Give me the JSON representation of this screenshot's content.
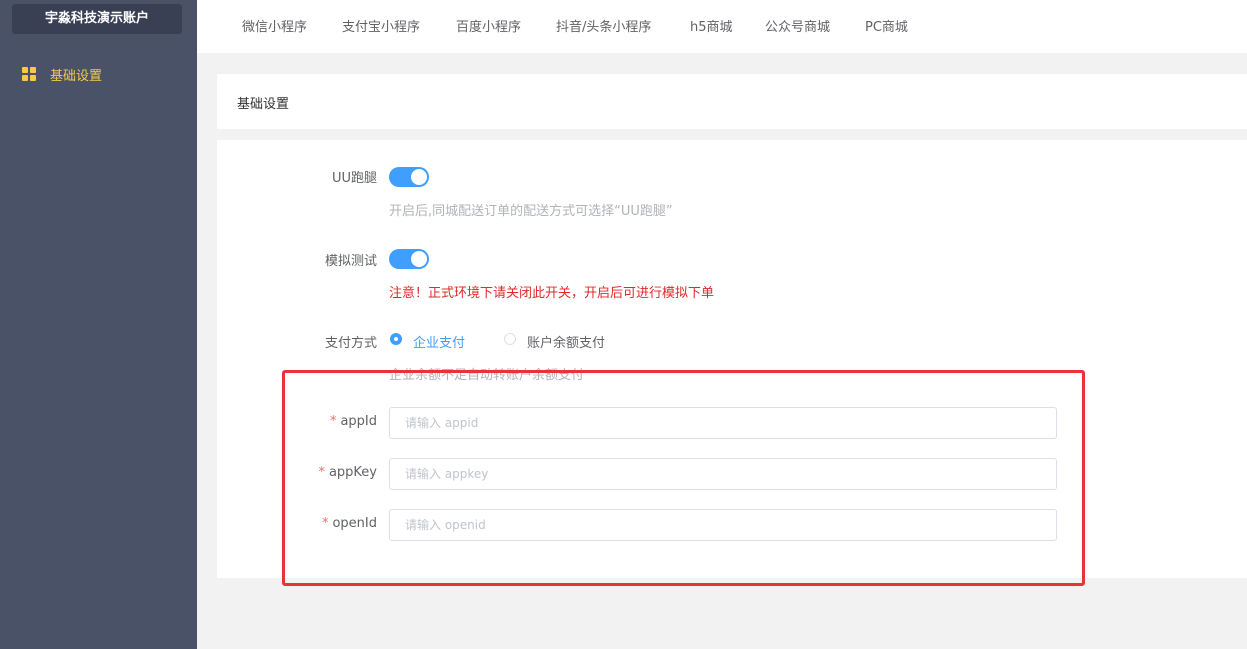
{
  "sidebar": {
    "account_name": "宇淼科技演示账户",
    "items": [
      {
        "label": "基础设置",
        "icon": "grid-icon",
        "active": true
      }
    ]
  },
  "topnav": {
    "tabs": [
      {
        "label": "微信小程序"
      },
      {
        "label": "支付宝小程序"
      },
      {
        "label": "百度小程序"
      },
      {
        "label": "抖音/头条小程序"
      },
      {
        "label": "h5商城"
      },
      {
        "label": "公众号商城"
      },
      {
        "label": "PC商城"
      }
    ]
  },
  "page": {
    "title": "基础设置"
  },
  "form": {
    "uu": {
      "label": "UU跑腿",
      "enabled": true,
      "tip": "开启后,同城配送订单的配送方式可选择“UU跑腿”"
    },
    "test": {
      "label": "模拟测试",
      "enabled": true,
      "tip": "注意！正式环境下请关闭此开关，开启后可进行模拟下单"
    },
    "payment": {
      "label": "支付方式",
      "options": [
        {
          "label": "企业支付",
          "checked": true
        },
        {
          "label": "账户余额支付",
          "checked": false
        }
      ],
      "tip": "企业余额不足自动转账户余额支付"
    },
    "appid": {
      "required_mark": "*",
      "label": "appId",
      "value": "",
      "placeholder": "请输入 appid"
    },
    "appkey": {
      "required_mark": "*",
      "label": "appKey",
      "value": "",
      "placeholder": "请输入 appkey"
    },
    "openid": {
      "required_mark": "*",
      "label": "openId",
      "value": "",
      "placeholder": "请输入 openid"
    }
  },
  "colors": {
    "sidebar_bg": "#4a5268",
    "accent_yellow": "#f7c948",
    "primary": "#409eff",
    "warning_red": "#e0292a",
    "highlight_border": "#e8323c"
  }
}
